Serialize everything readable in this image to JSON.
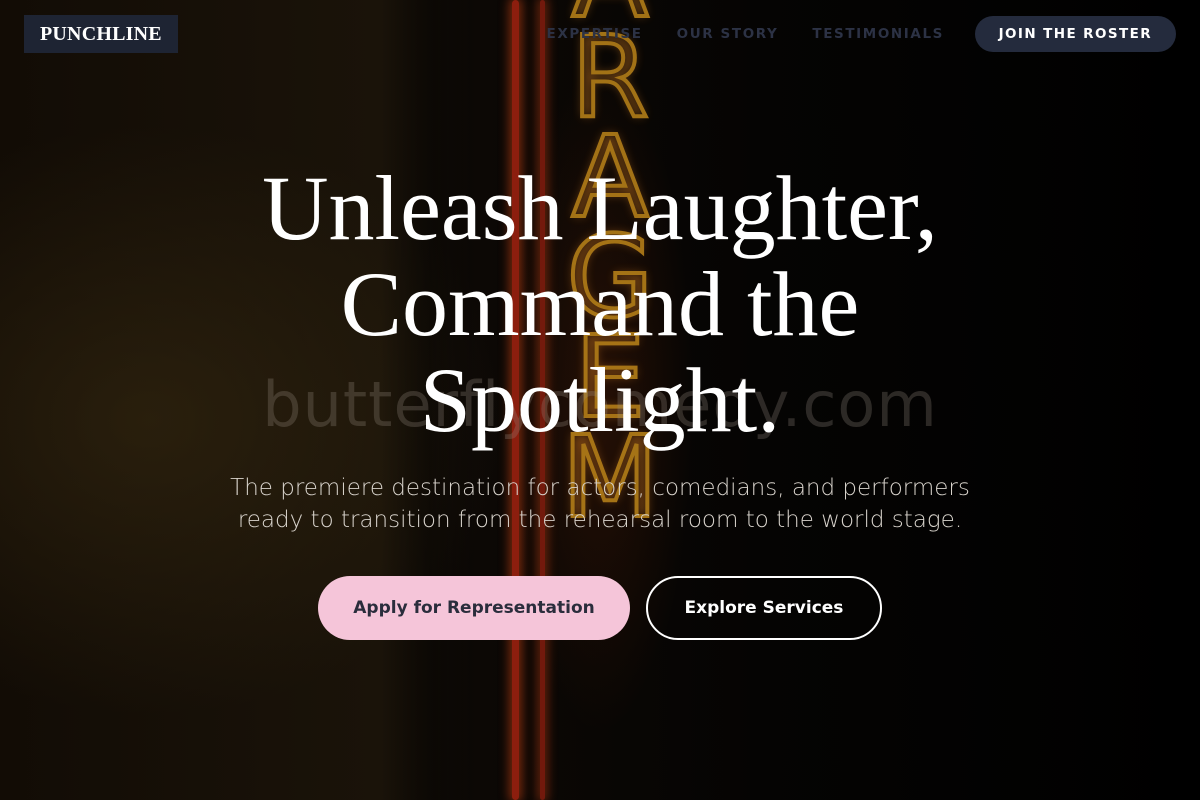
{
  "header": {
    "logo": "PUNCHLINE",
    "nav": [
      {
        "label": "EXPERTISE"
      },
      {
        "label": "OUR STORY"
      },
      {
        "label": "TESTIMONIALS"
      }
    ],
    "cta_label": "JOIN THE ROSTER"
  },
  "background": {
    "sign_letters": [
      "A",
      "R",
      "A",
      "G",
      "E",
      "M"
    ],
    "watermark": "butterflycomedy.com"
  },
  "hero": {
    "title_lines": [
      "Unleash Laughter,",
      "Command the",
      "Spotlight."
    ],
    "subtitle_lines": [
      "The premiere destination for actors, comedians, and performers",
      "ready to transition from the rehearsal room to the world stage."
    ],
    "primary_button": "Apply for Representation",
    "secondary_button": "Explore Services"
  },
  "colors": {
    "logo_bg": "#1e2433",
    "cta_bg": "#242b3d",
    "nav_text": "#2c3245",
    "primary_button_bg": "#f5c5d9",
    "primary_button_text": "#2a2d3c",
    "title_text": "#ffffff",
    "subtitle_text": "#d8d3cc",
    "neon_letters": "#c48a1a",
    "neon_tube": "#8c1e0e"
  }
}
